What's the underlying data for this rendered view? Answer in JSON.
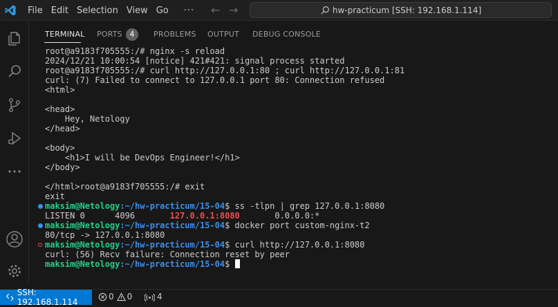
{
  "titlebar": {
    "menu": [
      "File",
      "Edit",
      "Selection",
      "View",
      "Go"
    ],
    "more": "···",
    "search_text": "hw-practicum [SSH: 192.168.1.114]"
  },
  "panel": {
    "tabs": [
      {
        "label": "TERMINAL",
        "active": true
      },
      {
        "label": "PORTS",
        "active": false
      },
      {
        "label": "PROBLEMS",
        "active": false
      },
      {
        "label": "OUTPUT",
        "active": false
      },
      {
        "label": "DEBUG CONSOLE",
        "active": false
      }
    ],
    "ports_count": "4"
  },
  "terminal": {
    "lines": [
      "root@a9183f705555:/# nginx -s reload",
      "2024/12/21 10:00:54 [notice] 421#421: signal process started",
      "root@a9183f705555:/# curl http://127.0.0.1:80 ; curl http://127.0.0.1:81",
      "curl: (7) Failed to connect to 127.0.0.1 port 80: Connection refused",
      "<html>",
      "",
      "<head>",
      "    Hey, Netology",
      "</head>",
      "",
      "<body>",
      "    <h1>I will be DevOps Engineer!</h1>",
      "</body>",
      "",
      "</html>root@a9183f705555:/# exit",
      "exit"
    ],
    "prompt_user": "maksim@Netology",
    "prompt_path": ":~/hw-practicum/15-04",
    "cmd1": "$ ss -tlpn | grep 127.0.0.1:8080",
    "listen_pre": "LISTEN 0      4096       ",
    "listen_addr": "127.0.0.1:8080",
    "listen_post": "       0.0.0.0:*",
    "cmd2": "$ docker port custom-nginx-t2",
    "port_map": "80/tcp -> 127.0.0.1:8080",
    "cmd3": "$ curl http://127.0.0.1:8080",
    "curl_err": "curl: (56) Recv failure: Connection reset by peer",
    "cmd4": "$ "
  },
  "statusbar": {
    "remote": "SSH: 192.168.1.114",
    "errors": "0",
    "warnings": "0",
    "ports": "4"
  },
  "colors": {
    "accent": "#0078d4",
    "prompt_green": "#23d18b",
    "path_blue": "#3b8eea",
    "highlight_red": "#f14c4c"
  },
  "icons": [
    "vscode-logo-icon",
    "back-arrow-icon",
    "forward-arrow-icon",
    "search-icon",
    "explorer-icon",
    "search-view-icon",
    "source-control-icon",
    "run-debug-icon",
    "more-icon",
    "account-icon",
    "settings-gear-icon",
    "remote-icon",
    "error-icon",
    "warning-icon",
    "ports-icon"
  ]
}
